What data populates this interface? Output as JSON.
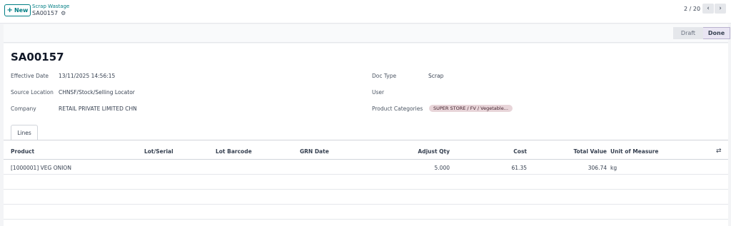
{
  "topbar": {
    "new_button": "New",
    "breadcrumb_parent": "Scrap Wastage",
    "record_name": "SA00157",
    "pager": "2 / 20"
  },
  "statusbar": {
    "stages": [
      "Draft",
      "Done"
    ],
    "active": "Done"
  },
  "form": {
    "title": "SA00157",
    "fields_left": [
      {
        "label": "Effective Date",
        "value": "13/11/2025 14:56:15"
      },
      {
        "label": "Source Location",
        "value": "CHNSF/Stock/Selling Locator"
      },
      {
        "label": "Company",
        "value": "RETAIL PRIVATE LIMITED CHN"
      }
    ],
    "fields_right": [
      {
        "label": "Doc Type",
        "value": "Scrap"
      },
      {
        "label": "User",
        "value": ""
      },
      {
        "label": "Product Categories",
        "value": "SUPER STORE / FV / Vegetable..."
      }
    ],
    "tab": "Lines"
  },
  "lines": {
    "columns": [
      "Product",
      "Lot/Serial",
      "Lot Barcode",
      "GRN Date",
      "Adjust Qty",
      "Cost",
      "Total Value",
      "Unit of Measure"
    ],
    "rows": [
      {
        "product": "[1000001] VEG ONION",
        "lot_serial": "",
        "lot_barcode": "",
        "grn_date": "",
        "adjust_qty": "5.000",
        "cost": "61.35",
        "total_value": "306.74",
        "uom": "kg"
      }
    ]
  },
  "icons": {
    "new": "plus-icon",
    "gear": "gear-icon",
    "prev": "chevron-left-icon",
    "next": "chevron-right-icon",
    "optional_columns": "swap-icon"
  },
  "colors": {
    "accent": "#017e84",
    "tag_bg": "#e8d5d9"
  }
}
